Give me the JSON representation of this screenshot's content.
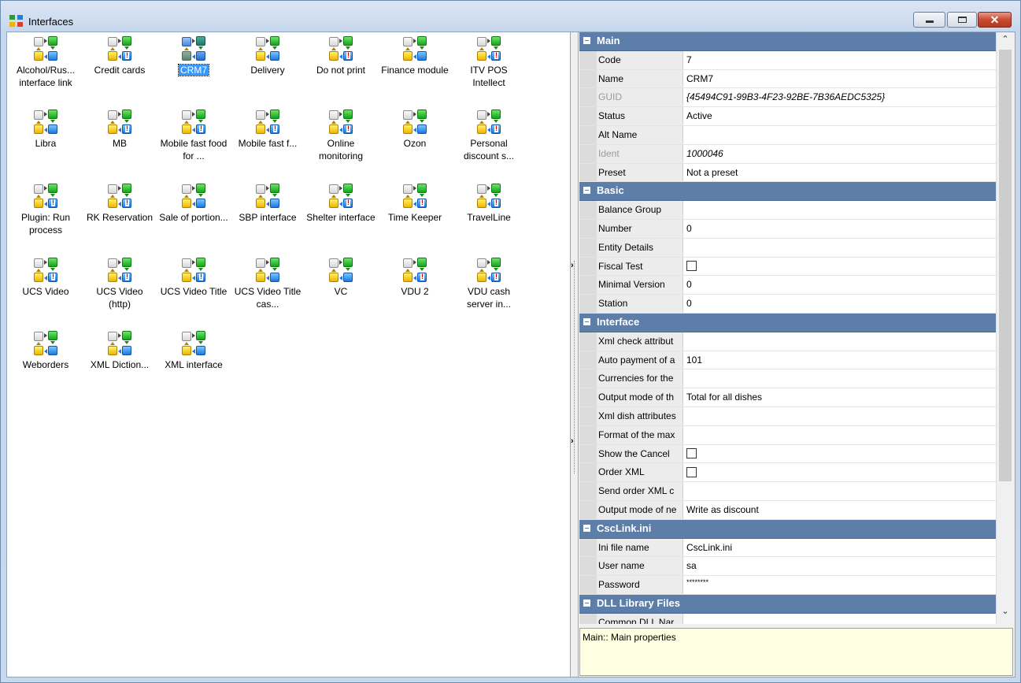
{
  "window": {
    "title": "Interfaces",
    "minimize_label": "",
    "maximize_label": "",
    "close_label": "✕"
  },
  "icons": [
    {
      "label": "Alcohol/Rus... interface link",
      "badge": false
    },
    {
      "label": "Credit cards",
      "badge": true
    },
    {
      "label": "CRM7",
      "badge": false,
      "selected": true
    },
    {
      "label": "Delivery",
      "badge": false
    },
    {
      "label": "Do not print",
      "badge": true
    },
    {
      "label": "Finance module",
      "badge": false
    },
    {
      "label": "ITV POS Intellect",
      "badge": true
    },
    {
      "label": "Libra",
      "badge": false
    },
    {
      "label": "MB",
      "badge": true
    },
    {
      "label": "Mobile fast food for ...",
      "badge": true
    },
    {
      "label": "Mobile fast f...",
      "badge": true
    },
    {
      "label": "Online monitoring",
      "badge": true
    },
    {
      "label": "Ozon",
      "badge": false
    },
    {
      "label": "Personal discount s...",
      "badge": true
    },
    {
      "label": "Plugin: Run process",
      "badge": true
    },
    {
      "label": "RK Reservation",
      "badge": true
    },
    {
      "label": "Sale of portion...",
      "badge": false
    },
    {
      "label": "SBP interface",
      "badge": false
    },
    {
      "label": "Shelter interface",
      "badge": true
    },
    {
      "label": "Time Keeper",
      "badge": true
    },
    {
      "label": "TravelLine",
      "badge": true
    },
    {
      "label": "UCS Video",
      "badge": true
    },
    {
      "label": "UCS Video (http)",
      "badge": true
    },
    {
      "label": "UCS Video Title",
      "badge": true
    },
    {
      "label": "UCS Video Title cas...",
      "badge": false
    },
    {
      "label": "VC",
      "badge": false
    },
    {
      "label": "VDU 2",
      "badge": true
    },
    {
      "label": "VDU cash server in...",
      "badge": true
    },
    {
      "label": "Weborders",
      "badge": false
    },
    {
      "label": "XML Diction...",
      "badge": false
    },
    {
      "label": "XML interface",
      "badge": false
    }
  ],
  "properties": [
    {
      "type": "cat",
      "name": "Main"
    },
    {
      "name": "Code",
      "value": "7"
    },
    {
      "name": "Name",
      "value": "CRM7"
    },
    {
      "name": "GUID",
      "value": "{45494C91-99B3-4F23-92BE-7B36AEDC5325}",
      "disabled": true
    },
    {
      "name": "Status",
      "value": "Active"
    },
    {
      "name": "Alt Name",
      "value": ""
    },
    {
      "name": "Ident",
      "value": "1000046",
      "disabled": true
    },
    {
      "name": "Preset",
      "value": "Not a preset"
    },
    {
      "type": "cat",
      "name": "Basic"
    },
    {
      "name": "Balance Group",
      "value": ""
    },
    {
      "name": "Number",
      "value": "0"
    },
    {
      "name": "Entity Details",
      "value": ""
    },
    {
      "name": "Fiscal Test",
      "value": "",
      "checkbox": true
    },
    {
      "name": "Minimal Version",
      "value": "0"
    },
    {
      "name": "Station",
      "value": "0"
    },
    {
      "type": "cat",
      "name": "Interface"
    },
    {
      "name": "Xml check attribut",
      "value": ""
    },
    {
      "name": "Auto payment of a",
      "value": "101"
    },
    {
      "name": "Currencies for the",
      "value": ""
    },
    {
      "name": "Output mode of th",
      "value": "Total for all dishes"
    },
    {
      "name": "Xml dish attributes",
      "value": ""
    },
    {
      "name": "Format of the max",
      "value": ""
    },
    {
      "name": "Show the Cancel",
      "value": "",
      "checkbox": true
    },
    {
      "name": "Order XML",
      "value": "",
      "checkbox": true
    },
    {
      "name": "Send order XML c",
      "value": ""
    },
    {
      "name": "Output mode of ne",
      "value": "Write as discount"
    },
    {
      "type": "cat",
      "name": "CscLink.ini"
    },
    {
      "name": "Ini file name",
      "value": "CscLink.ini"
    },
    {
      "name": "User name",
      "value": "sa"
    },
    {
      "name": "Password",
      "value": "********",
      "password": true
    },
    {
      "type": "cat",
      "name": "DLL Library Files"
    },
    {
      "name": "Common DLL Nar",
      "value": ""
    }
  ],
  "scroll": {
    "up": "⌃",
    "down": "⌄"
  },
  "help_text": "Main:: Main properties",
  "splitter": {
    "arrow": "›"
  }
}
